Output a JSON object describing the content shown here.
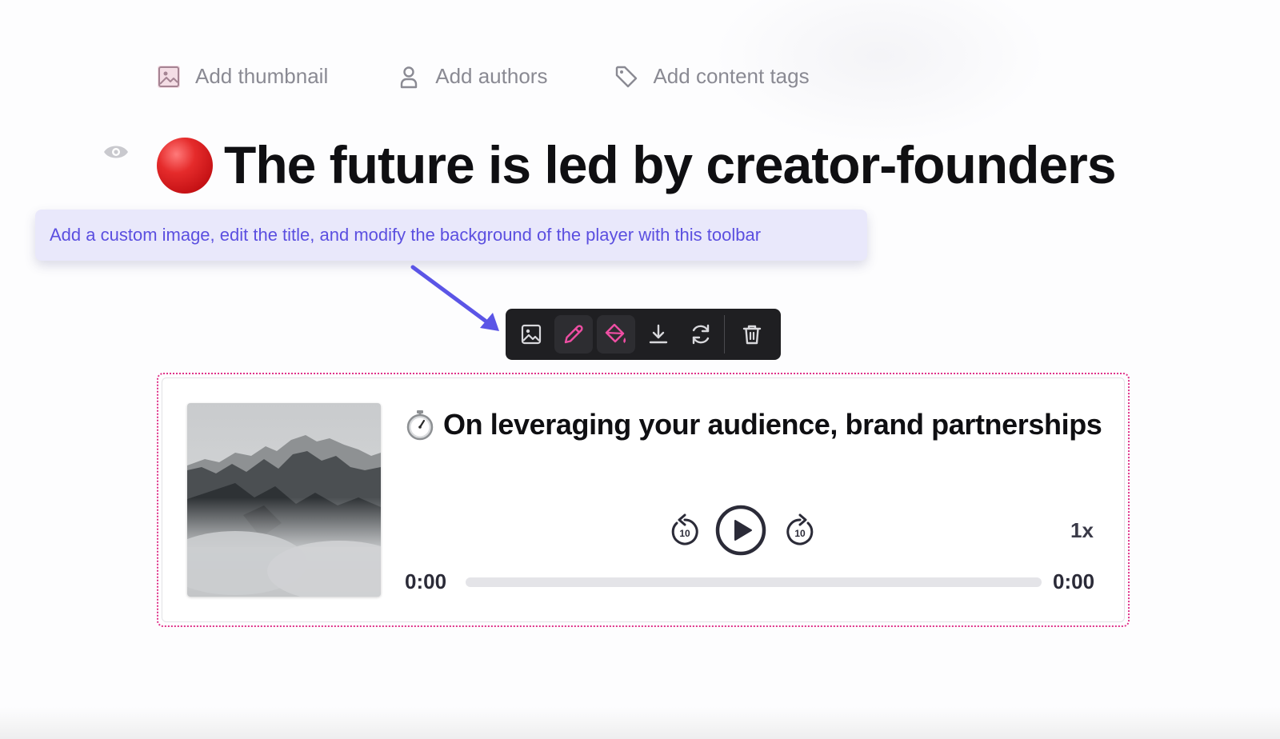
{
  "meta_bar": {
    "thumbnail_label": "Add thumbnail",
    "authors_label": "Add authors",
    "tags_label": "Add content tags"
  },
  "title": {
    "emoji": "red-circle",
    "text": "The future is led by creator-founders"
  },
  "tooltip": {
    "text": "Add a custom image, edit the title, and modify the background of the player with this toolbar"
  },
  "block_toolbar": {
    "buttons": [
      {
        "icon": "image-icon",
        "active": false
      },
      {
        "icon": "pencil-icon",
        "active": true
      },
      {
        "icon": "paint-bucket-icon",
        "active": true
      },
      {
        "icon": "download-icon",
        "active": false
      },
      {
        "icon": "refresh-icon",
        "active": false
      },
      {
        "icon": "trash-icon",
        "active": false
      }
    ]
  },
  "player": {
    "cover_icon": "mountain-image",
    "title_emoji": "stopwatch",
    "title": "On leveraging your audience, brand partnerships",
    "rewind_label": "10",
    "forward_label": "10",
    "speed": "1x",
    "current_time": "0:00",
    "total_time": "0:00",
    "progress": 0
  },
  "colors": {
    "accent_pink": "#e0338a",
    "tooltip_text": "#5b4fe0",
    "tooltip_bg": "#e9e8fb",
    "toolbar_bg": "#1f1f22",
    "toolbar_active_icon": "#ee4ea3"
  }
}
